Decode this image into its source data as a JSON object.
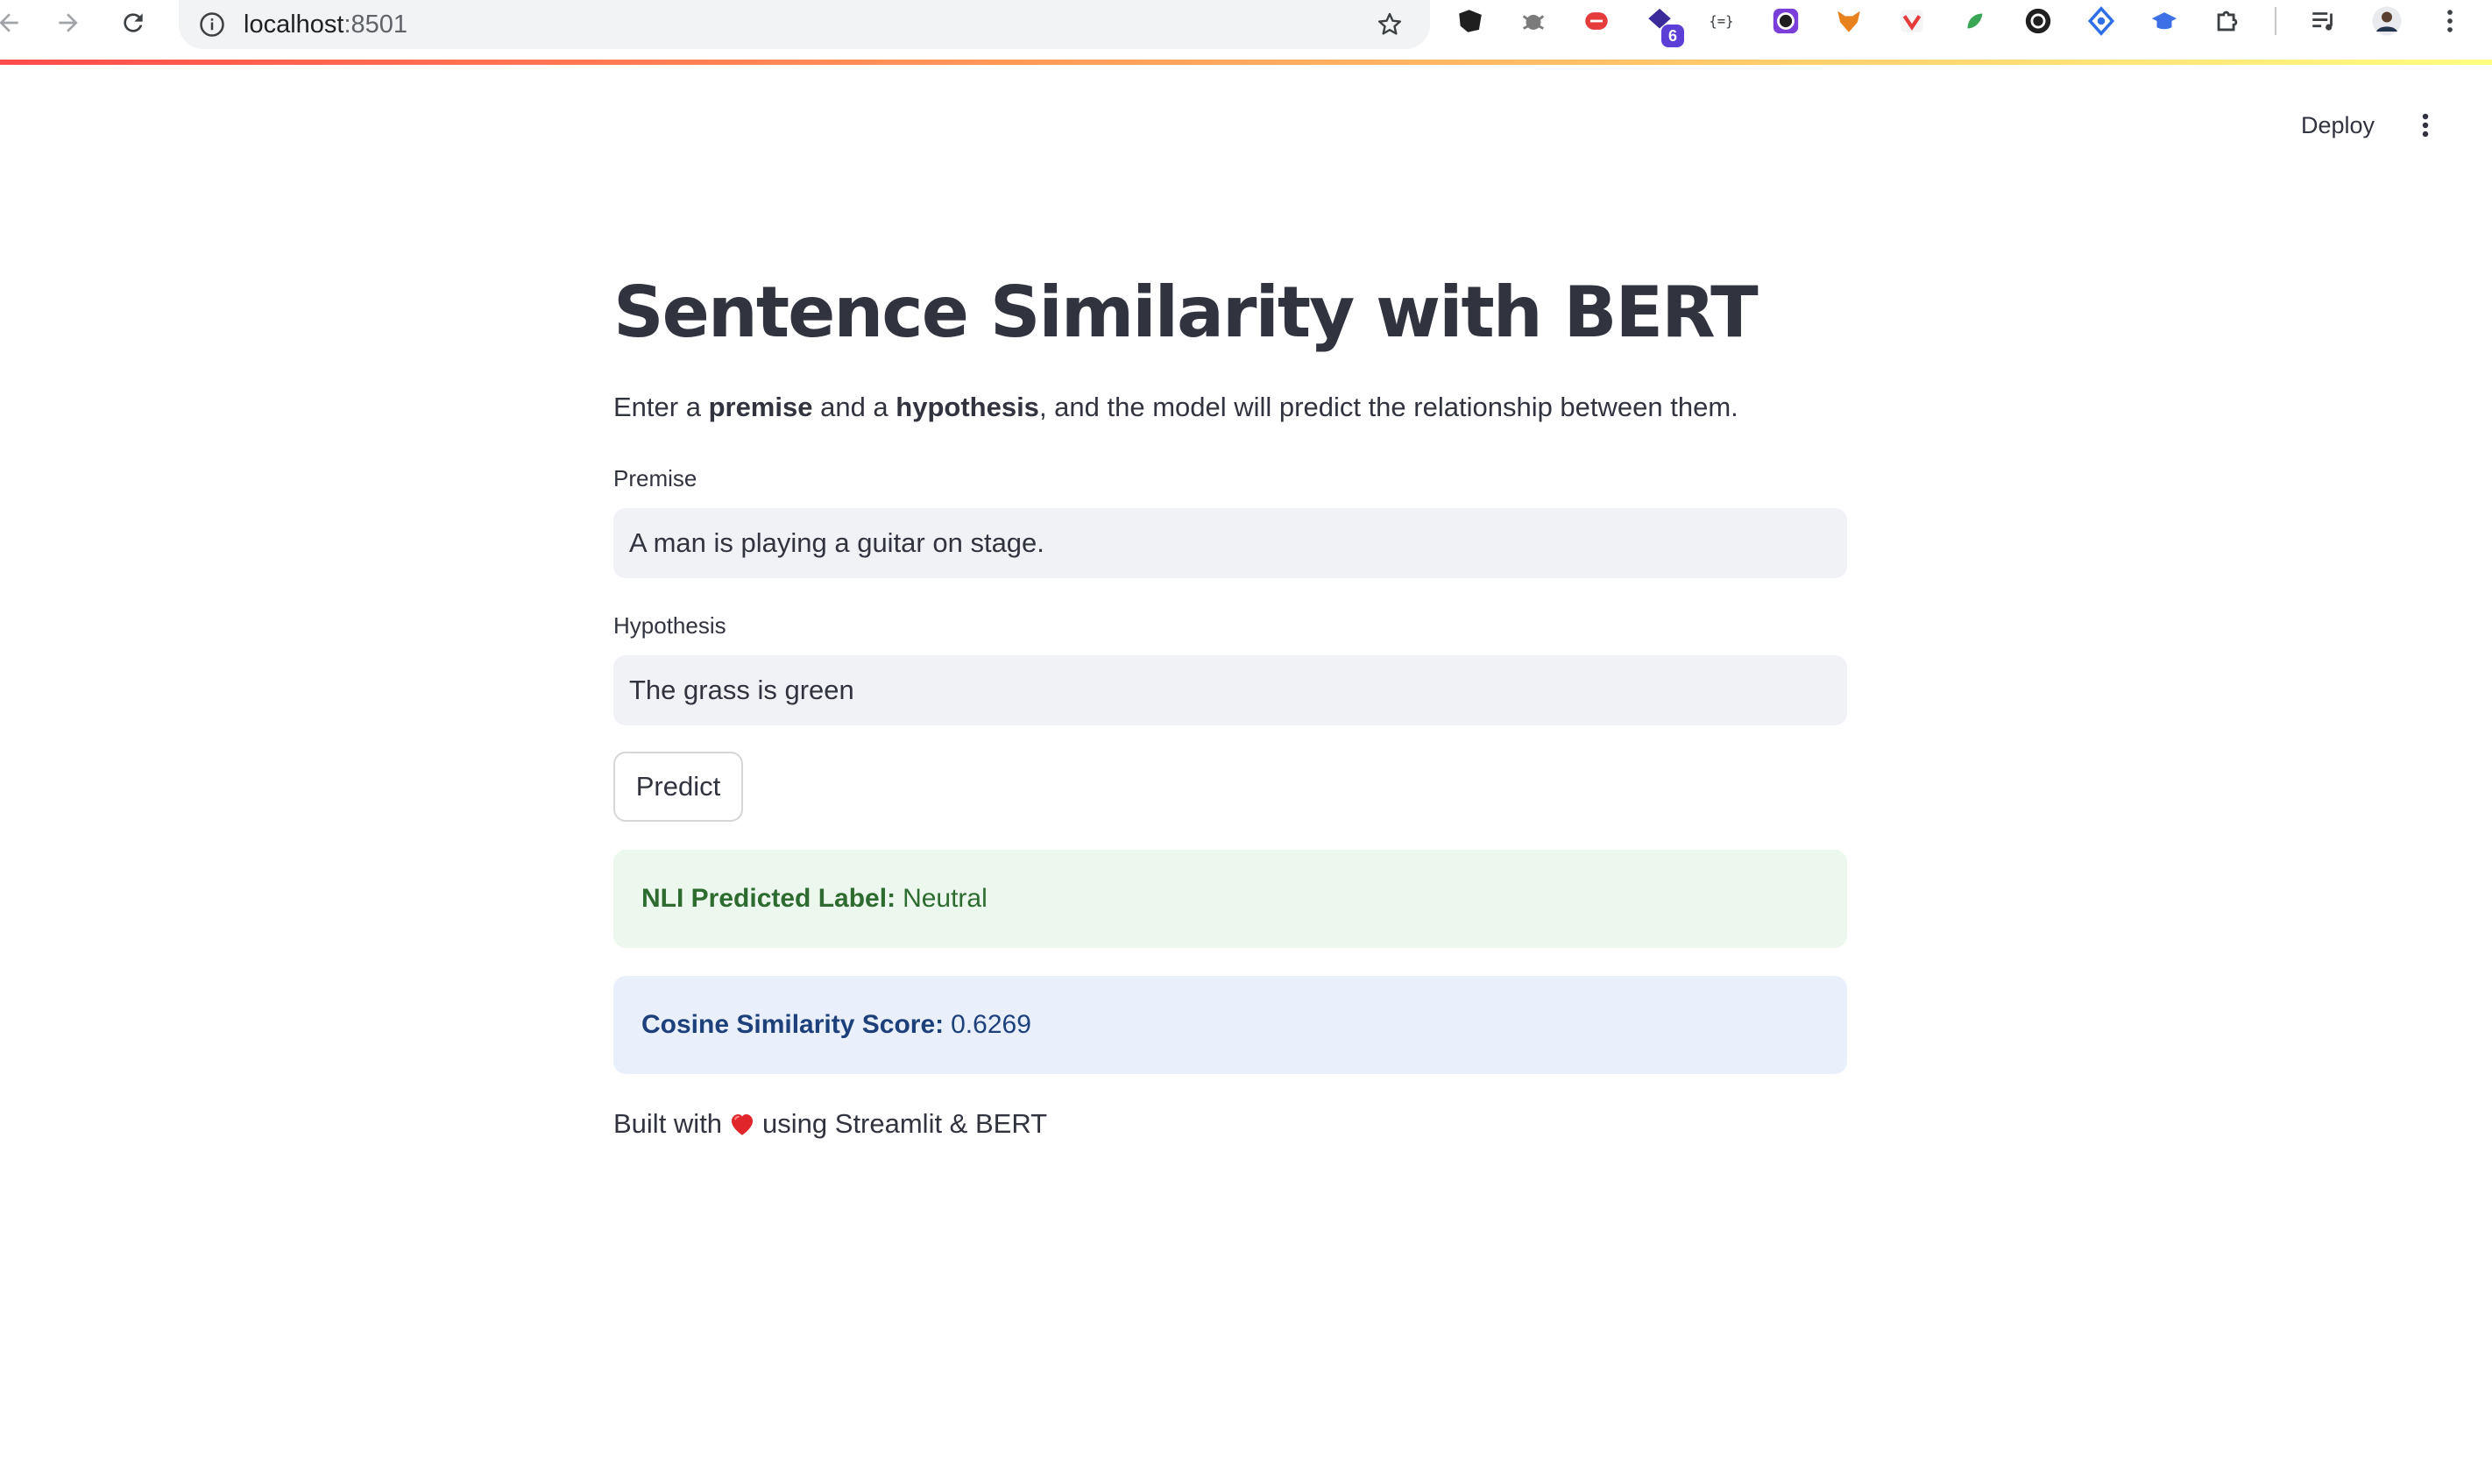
{
  "browser": {
    "url_host": "localhost",
    "url_port": ":8501",
    "extension_badge": "6",
    "extensions": [
      "extension-dark-icon",
      "extension-bug-icon",
      "extension-red-icon",
      "extension-purple-icon",
      "extension-json-icon",
      "extension-circle-icon",
      "extension-fox-icon",
      "extension-check-icon",
      "extension-leaf-icon",
      "extension-wheel-icon",
      "extension-diamond-icon",
      "extension-cap-icon",
      "extensions-puzzle-icon"
    ]
  },
  "header": {
    "deploy_label": "Deploy"
  },
  "main": {
    "title": "Sentence Similarity with BERT",
    "intro": {
      "part1": "Enter a ",
      "bold1": "premise",
      "part2": " and a ",
      "bold2": "hypothesis",
      "part3": ", and the model will predict the relationship between them."
    },
    "premise": {
      "label": "Premise",
      "value": "A man is playing a guitar on stage."
    },
    "hypothesis": {
      "label": "Hypothesis",
      "value": "The grass is green"
    },
    "predict_label": "Predict",
    "nli_result": {
      "key": "NLI Predicted Label:",
      "value": "Neutral"
    },
    "cosine_result": {
      "key": "Cosine Similarity Score:",
      "value": "0.6269"
    },
    "footer": {
      "before": "Built with",
      "after": "using Streamlit & BERT"
    }
  },
  "colors": {
    "success_bg": "#ecf7ed",
    "success_text": "#2e6b30",
    "info_bg": "#e9f0fc",
    "info_text": "#1d3f7a",
    "accent": "#ff4b4b"
  }
}
